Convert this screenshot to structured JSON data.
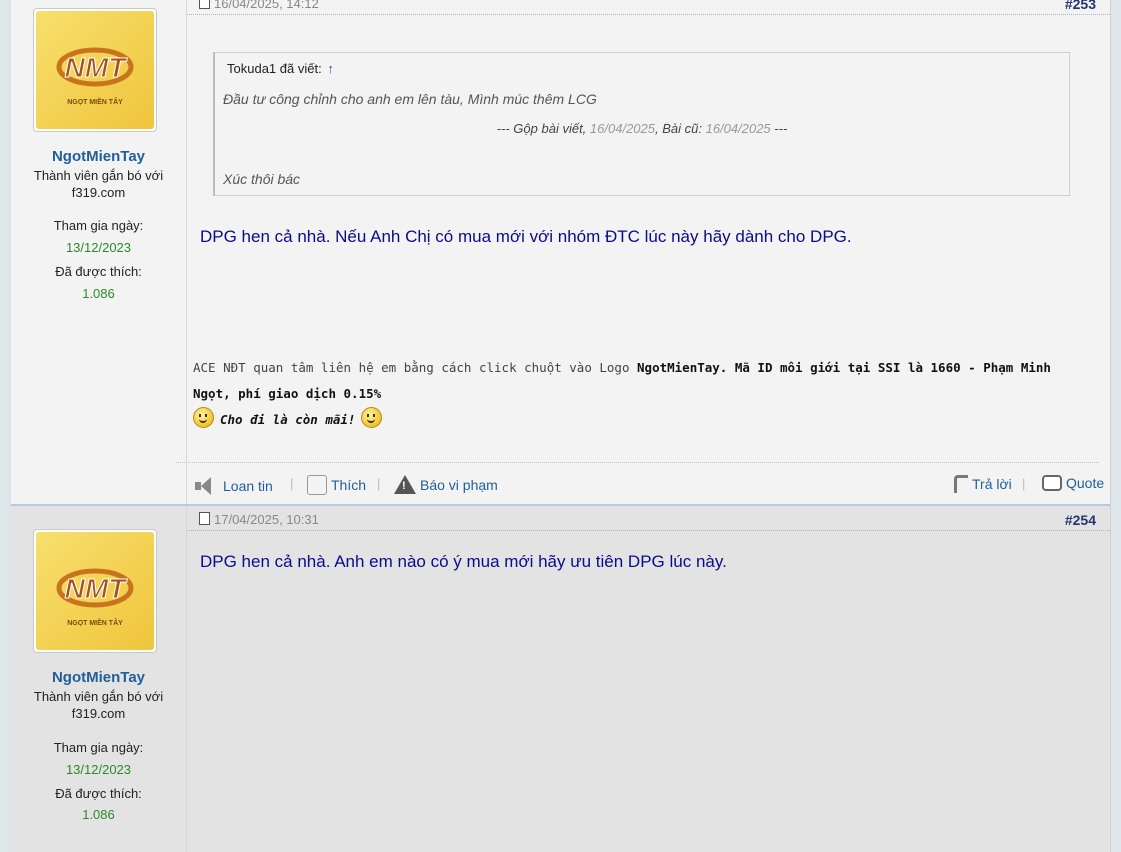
{
  "posts": [
    {
      "user": {
        "name": "NgotMienTay",
        "title": "Thành viên gắn bó với f319.com",
        "joined_label": "Tham gia ngày:",
        "joined": "13/12/2023",
        "likes_label": "Đã được thích:",
        "likes": "1.086",
        "avatar_text": "NMT",
        "avatar_subtext": "NGỌT MIỀN TÂY"
      },
      "date": "16/04/2025, 14:12",
      "number": "#253",
      "quote": {
        "author": "Tokuda1 đã viết:",
        "arrow": "↑",
        "line1": "Đầu tư công chỉnh cho anh em lên tàu, Mình múc thêm LCG",
        "merge_prefix": "--- Gộp bài viết,",
        "merge_date": "16/04/2025",
        "merge_old_label": ", Bài cũ:",
        "merge_old_date": "16/04/2025",
        "merge_suffix": "---",
        "line2": "Xúc thôi bác"
      },
      "message": "DPG hen cả nhà. Nếu Anh Chị có mua mới với nhóm ĐTC lúc này hãy dành cho DPG.",
      "signature": {
        "part1": "ACE NĐT quan tâm liên hệ em bằng cách click chuột vào Logo ",
        "part1_bold": "NgotMienTay. Mã ID môi giới tại SSI là 1660 - Phạm Minh Ngọt, phí giao dịch 0.15%",
        "motto": "Cho đi là còn mãi!"
      },
      "actions": {
        "share": "Loan tin",
        "like": "Thích",
        "report": "Báo vi phạm",
        "reply": "Trả lời",
        "quote": "Quote"
      }
    },
    {
      "user": {
        "name": "NgotMienTay",
        "title": "Thành viên gắn bó với f319.com",
        "joined_label": "Tham gia ngày:",
        "joined": "13/12/2023",
        "likes_label": "Đã được thích:",
        "likes": "1.086",
        "avatar_text": "NMT",
        "avatar_subtext": "NGỌT MIỀN TÂY"
      },
      "date": "17/04/2025, 10:31",
      "number": "#254",
      "message": "DPG hen cả nhà. Anh em nào có ý mua mới hãy ưu tiên DPG lúc này."
    }
  ],
  "colors": {
    "username": "#1f5f99",
    "message": "#0b0b8c",
    "stat_value": "#2a8a2a",
    "post_number": "#24356f"
  }
}
